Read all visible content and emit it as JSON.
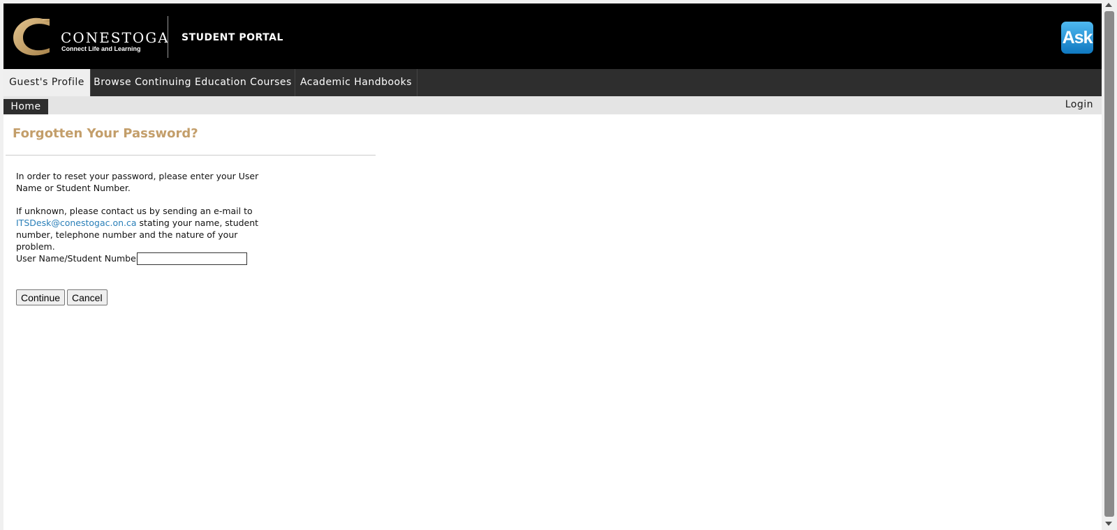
{
  "header": {
    "brand_name": "CONESTOGA",
    "brand_tagline": "Connect Life and Learning",
    "portal_title": "STUDENT PORTAL",
    "ask_label": "Ask"
  },
  "tabs": [
    {
      "label": "Guest's Profile",
      "active": true
    },
    {
      "label": "Browse Continuing Education Courses",
      "active": false
    },
    {
      "label": "Academic Handbooks",
      "active": false
    }
  ],
  "subnav": {
    "home_label": "Home",
    "login_label": "Login"
  },
  "content": {
    "title": "Forgotten Your Password?",
    "intro": "In order to reset your password, please enter your User Name or Student Number.",
    "contact_before": "If unknown, please contact us by sending an e-mail to",
    "contact_email": "ITSDesk@conestogac.on.ca",
    "contact_after": "stating your name, student number, telephone number and the nature of your problem.",
    "field_label": "User Name/Student Number:",
    "field_value": "",
    "continue_label": "Continue",
    "cancel_label": "Cancel"
  },
  "colors": {
    "title": "#c39e6a",
    "link": "#2a7fb8",
    "header_bg": "#000000",
    "tabbar_bg": "#2e2e2e",
    "logo_gold": "#c9a66b"
  },
  "icons": {
    "logo": "conestoga-c-logo-icon",
    "ask": "ask-help-icon"
  }
}
